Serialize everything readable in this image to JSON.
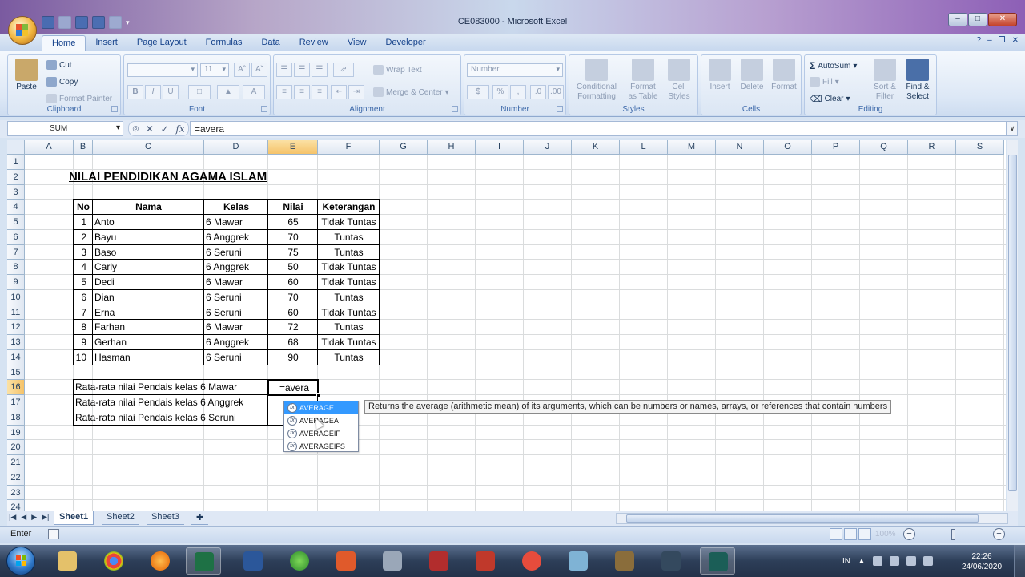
{
  "window": {
    "title": "CE083000  -  Microsoft Excel"
  },
  "ribbon": {
    "tabs": [
      "Home",
      "Insert",
      "Page Layout",
      "Formulas",
      "Data",
      "Review",
      "View",
      "Developer"
    ],
    "active_tab": "Home",
    "clipboard": {
      "label": "Clipboard",
      "paste": "Paste",
      "cut": "Cut",
      "copy": "Copy",
      "format_painter": "Format Painter"
    },
    "font": {
      "label": "Font",
      "size": "11"
    },
    "alignment": {
      "label": "Alignment",
      "wrap_text": "Wrap Text",
      "merge_center": "Merge & Center"
    },
    "number": {
      "label": "Number",
      "format": "Number"
    },
    "styles": {
      "label": "Styles",
      "conditional_formatting": [
        "Conditional",
        "Formatting"
      ],
      "format_as_table": [
        "Format",
        "as Table"
      ],
      "cell_styles": [
        "Cell",
        "Styles"
      ]
    },
    "cells": {
      "label": "Cells",
      "insert": "Insert",
      "delete": "Delete",
      "format": "Format"
    },
    "editing": {
      "label": "Editing",
      "autosum": "AutoSum",
      "fill": "Fill",
      "clear": "Clear",
      "sort_filter": [
        "Sort &",
        "Filter"
      ],
      "find_select": [
        "Find &",
        "Select"
      ]
    }
  },
  "formula_bar": {
    "name_box": "SUM",
    "value": "=avera"
  },
  "columns": [
    "A",
    "B",
    "C",
    "D",
    "E",
    "F",
    "G",
    "H",
    "I",
    "J",
    "K",
    "L",
    "M",
    "N",
    "O",
    "P",
    "Q",
    "R",
    "S"
  ],
  "rows": [
    "1",
    "2",
    "3",
    "4",
    "5",
    "6",
    "7",
    "8",
    "9",
    "10",
    "11",
    "12",
    "13",
    "14",
    "15",
    "16",
    "17",
    "18",
    "19",
    "20",
    "21",
    "22",
    "23",
    "24"
  ],
  "sheet": {
    "title": "NILAI PENDIDIKAN AGAMA ISLAM",
    "headers": [
      "No",
      "Nama",
      "Kelas",
      "Nilai",
      "Keterangan"
    ],
    "data": [
      [
        "1",
        "Anto",
        "6 Mawar",
        "65",
        "Tidak Tuntas"
      ],
      [
        "2",
        "Bayu",
        "6 Anggrek",
        "70",
        "Tuntas"
      ],
      [
        "3",
        "Baso",
        "6 Seruni",
        "75",
        "Tuntas"
      ],
      [
        "4",
        "Carly",
        "6 Anggrek",
        "50",
        "Tidak Tuntas"
      ],
      [
        "5",
        "Dedi",
        "6 Mawar",
        "60",
        "Tidak Tuntas"
      ],
      [
        "6",
        "Dian",
        "6 Seruni",
        "70",
        "Tuntas"
      ],
      [
        "7",
        "Erna",
        "6 Seruni",
        "60",
        "Tidak Tuntas"
      ],
      [
        "8",
        "Farhan",
        "6 Mawar",
        "72",
        "Tuntas"
      ],
      [
        "9",
        "Gerhan",
        "6 Anggrek",
        "68",
        "Tidak Tuntas"
      ],
      [
        "10",
        "Hasman",
        "6 Seruni",
        "90",
        "Tuntas"
      ]
    ],
    "summary": [
      "Rata-rata nilai Pendais kelas 6 Mawar",
      "Rata-rata nilai Pendais kelas 6 Anggrek",
      "Rata-rata nilai Pendais kelas 6 Seruni"
    ],
    "active_cell_value": "=avera"
  },
  "autocomplete": {
    "items": [
      "AVERAGE",
      "AVERAGEA",
      "AVERAGEIF",
      "AVERAGEIFS"
    ],
    "selected": "AVERAGE",
    "tooltip": "Returns the average (arithmetic mean) of its arguments, which can be numbers or names, arrays, or references that contain numbers"
  },
  "sheet_tabs": [
    "Sheet1",
    "Sheet2",
    "Sheet3"
  ],
  "status": {
    "mode": "Enter",
    "zoom": "100%"
  },
  "taskbar": {
    "apps": [
      "file-explorer",
      "chrome",
      "firefox",
      "excel",
      "word",
      "security",
      "store",
      "calculator",
      "kbbi",
      "book",
      "camera",
      "notes",
      "sublime",
      "media",
      "video-editor"
    ],
    "language": "IN",
    "time": "22:26",
    "date": "24/06/2020"
  },
  "colors": {
    "accent": "#15428b",
    "selected": "#3399ff",
    "header_select": "#f5c36a"
  }
}
